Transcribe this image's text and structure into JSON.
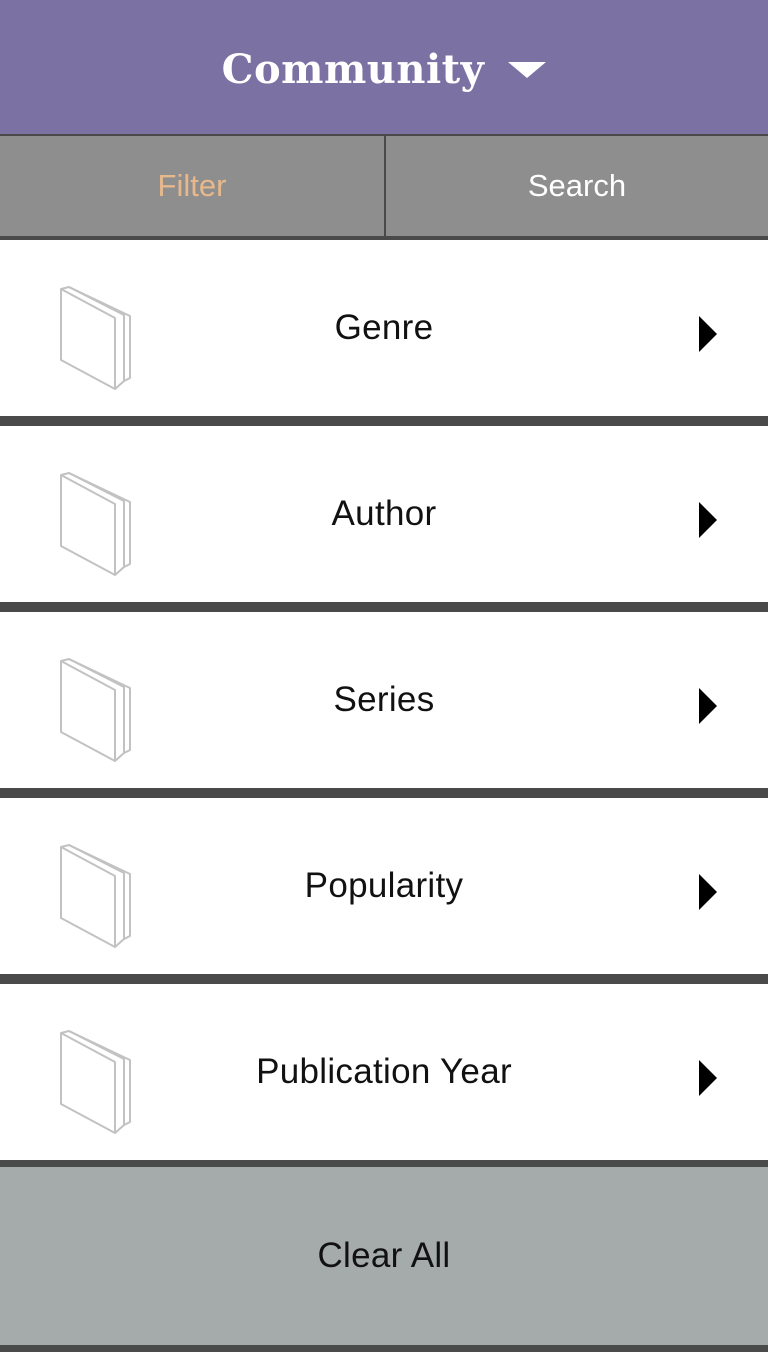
{
  "header": {
    "title": "Community",
    "dropdown_icon": "chevron-down-icon"
  },
  "tabs": [
    {
      "label": "Filter",
      "active": true
    },
    {
      "label": "Search",
      "active": false
    }
  ],
  "filters": [
    {
      "label": "Genre",
      "icon": "book-icon"
    },
    {
      "label": "Author",
      "icon": "book-icon"
    },
    {
      "label": "Series",
      "icon": "book-icon"
    },
    {
      "label": "Popularity",
      "icon": "book-icon"
    },
    {
      "label": "Publication Year",
      "icon": "book-icon"
    }
  ],
  "clear_all_label": "Clear All",
  "colors": {
    "header_bg": "#7b72a3",
    "active_tab_text": "#e6b88c",
    "tab_bg": "#8e8e8e",
    "clear_bg": "#a5aaaa"
  }
}
